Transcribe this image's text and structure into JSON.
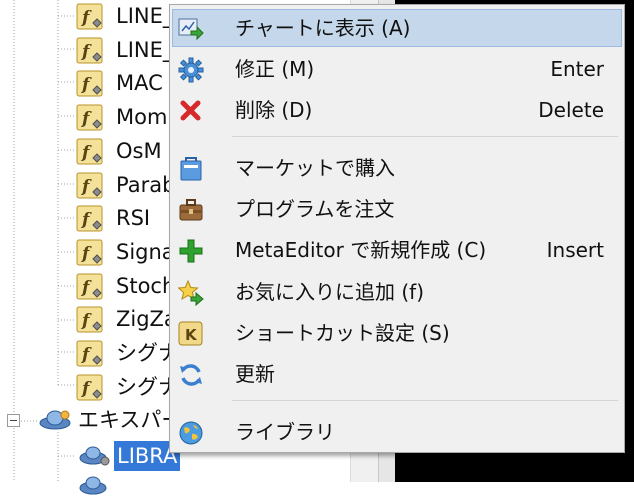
{
  "tree": {
    "indicators": [
      {
        "label": "LINE_",
        "icon": "indicator-icon"
      },
      {
        "label": "LINE_",
        "icon": "indicator-icon"
      },
      {
        "label": "MAC",
        "icon": "indicator-icon"
      },
      {
        "label": "Mom",
        "icon": "indicator-icon"
      },
      {
        "label": "OsM",
        "icon": "indicator-icon"
      },
      {
        "label": "Parab",
        "icon": "indicator-icon"
      },
      {
        "label": "RSI",
        "icon": "indicator-icon"
      },
      {
        "label": "Signa",
        "icon": "indicator-icon"
      },
      {
        "label": "Stoch",
        "icon": "indicator-icon"
      },
      {
        "label": "ZigZa",
        "icon": "indicator-icon"
      },
      {
        "label": "シグナ",
        "icon": "indicator-icon"
      },
      {
        "label": "シグナ",
        "icon": "indicator-icon"
      }
    ],
    "expert_folder": {
      "label": "エキスパー",
      "icon": "expert-advisor-icon"
    },
    "selected_item": {
      "label": "LIBRA",
      "icon": "expert-advisor-icon"
    }
  },
  "context_menu": {
    "items": [
      {
        "label": "チャートに表示 (A)",
        "shortcut": "",
        "icon": "show-on-chart-icon",
        "selected": true
      },
      {
        "label": "修正 (M)",
        "shortcut": "Enter",
        "icon": "gear-icon"
      },
      {
        "label": "削除 (D)",
        "shortcut": "Delete",
        "icon": "delete-icon"
      },
      {
        "label": "マーケットで購入",
        "shortcut": "",
        "icon": "market-basket-icon"
      },
      {
        "label": "プログラムを注文",
        "shortcut": "",
        "icon": "briefcase-icon"
      },
      {
        "label": "MetaEditor で新規作成 (C)",
        "shortcut": "Insert",
        "icon": "plus-icon"
      },
      {
        "label": "お気に入りに追加 (f)",
        "shortcut": "",
        "icon": "favorite-star-icon"
      },
      {
        "label": "ショートカット設定 (S)",
        "shortcut": "",
        "icon": "hotkey-k-icon"
      },
      {
        "label": "更新",
        "shortcut": "",
        "icon": "refresh-icon"
      },
      {
        "label": "ライブラリ",
        "shortcut": "",
        "icon": "globe-icon"
      }
    ]
  },
  "colors": {
    "selection_highlight": "#c5d7ea",
    "tree_selection": "#3478d8",
    "delete_red": "#d62a2a",
    "plus_green": "#2fa12f"
  }
}
